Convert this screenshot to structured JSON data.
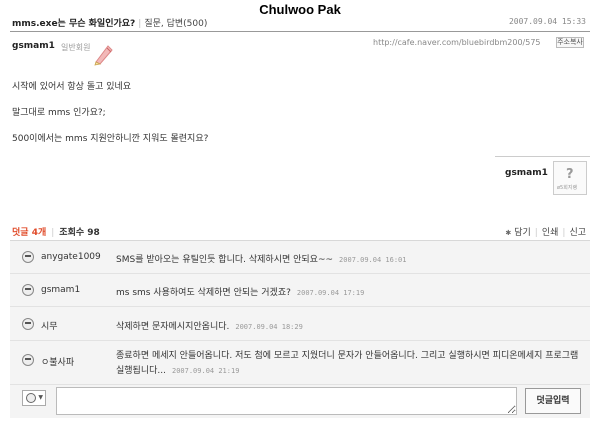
{
  "watermark": "Chulwoo Pak",
  "post": {
    "title": "mms.exe는 무슨 화일인가요?",
    "category": "질문, 답변(500)",
    "date": "2007.09.04 15:33",
    "author": "gsmam1",
    "member_level": "일반회원",
    "url": "http://cafe.naver.com/bluebirdbm200/575",
    "copy_label": "주소복사",
    "body": [
      "시작에 있어서 항상 돌고 있네요",
      "말그대로 mms 인가요?;",
      "500이에서는 mms 지원안하니깐 지워도 몰련지요?"
    ],
    "signature_name": "gsmam1",
    "signature_avatar_caption": "ø5회지랭"
  },
  "comments_bar": {
    "comments_label": "덧글 4개",
    "views_label": "조회수 98",
    "actions": [
      "담기",
      "인쇄",
      "신고"
    ]
  },
  "comments": [
    {
      "name": "anygate1009",
      "text": "SMS를 받아오는 유틸인듯 합니다. 삭제하시면 안되요~~",
      "date": "2007.09.04 16:01"
    },
    {
      "name": "gsmam1",
      "text": "ms sms 사용하여도 삭제하면 안되는 거겠죠?",
      "date": "2007.09.04 17:19"
    },
    {
      "name": "시무",
      "text": "삭제하면 문자메시지안옵니다.",
      "date": "2007.09.04 18:29"
    },
    {
      "name": "ㅇ불사파",
      "text": "종료하면 메세지 안들어옵니다. 저도 첨에 모르고 지웠더니 문자가 안들어옵니다. 그리고 실행하시면 피디온메세지 프로그램 실행됩니다...",
      "date": "2007.09.04 21:19"
    }
  ],
  "input": {
    "submit_label": "덧글입력"
  }
}
